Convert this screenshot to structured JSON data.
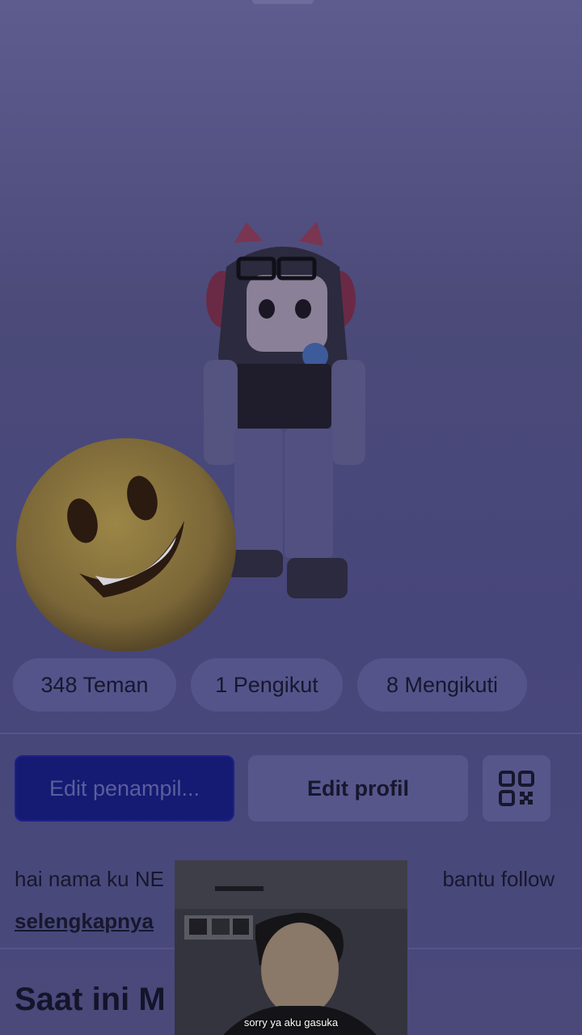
{
  "stats": {
    "friends": "348 Teman",
    "followers": "1 Pengikut",
    "following": "8 Mengikuti"
  },
  "buttons": {
    "edit_appearance": "Edit penampil...",
    "edit_profile": "Edit profil"
  },
  "bio": {
    "text_left": "hai nama ku NE",
    "text_right": "bantu follow",
    "more_link": "selengkapnya"
  },
  "section": {
    "title_partial": "Saat ini M"
  },
  "overlay": {
    "subtitle": "sorry ya aku gasuka"
  },
  "colors": {
    "background": "#4b4a79",
    "primary_button": "#151a73",
    "chip": "#55548a"
  },
  "icons": [
    "smiling-emoji-icon",
    "qr-code-icon"
  ]
}
